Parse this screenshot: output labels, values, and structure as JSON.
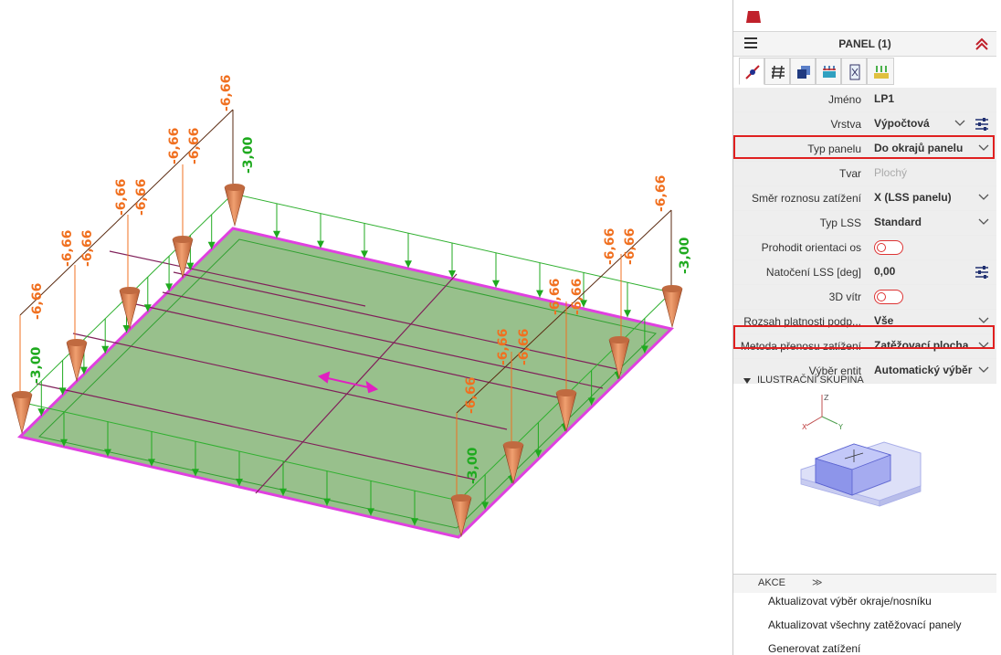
{
  "viewport": {
    "top_labels": [
      "-6,66",
      "-6,66",
      "-6,66",
      "-6,66",
      "-6,66",
      "-6,66",
      "-6,66",
      "-6,66",
      "-6,66",
      "-6,66",
      "-6,66",
      "-6,66",
      "-6,66",
      "-6,66",
      "-6,66",
      "-6,66"
    ],
    "green_labels": [
      "-3,00",
      "-3,00",
      "-3,00",
      "-3,00"
    ],
    "colors": {
      "panel_fill": "#98c08c",
      "panel_edge": "#e040e0",
      "load_top": "#f07020",
      "load_green": "#1faa1f",
      "cone": "#e0784a"
    }
  },
  "panel": {
    "title": "PANEL (1)",
    "tabs": [
      "geometry-tab",
      "layers-tab",
      "surface-tab",
      "load-tab",
      "document-tab",
      "structure-tab"
    ],
    "props": [
      {
        "key": "Jméno",
        "value": "LP1"
      },
      {
        "key": "Vrstva",
        "value": "Výpočtová"
      },
      {
        "key": "Typ panelu",
        "value": "Do okrajů panelu"
      },
      {
        "key": "Tvar",
        "value": "Plochý"
      },
      {
        "key": "Směr roznosu zatížení",
        "value": "X (LSS panelu)"
      },
      {
        "key": "Typ LSS",
        "value": "Standard"
      },
      {
        "key": "Prohodit orientaci os",
        "value": ""
      },
      {
        "key": "Natočení LSS [deg]",
        "value": "0,00"
      },
      {
        "key": "3D vítr",
        "value": ""
      },
      {
        "key": "Rozsah platnosti podp...",
        "value": "Vše"
      },
      {
        "key": "Metoda přenosu zatížení",
        "value": "Zatěžovací plocha"
      },
      {
        "key": "Výběr entit",
        "value": "Automatický výběr"
      }
    ],
    "section_title": "ILUSTRAČNÍ SKUPINA",
    "axes": {
      "z": "Z",
      "x": "X",
      "y": "Y"
    },
    "akce": {
      "label": "AKCE",
      "more": "≫"
    },
    "actions": [
      "Aktualizovat výběr okraje/nosníku",
      "Aktualizovat všechny zatěžovací panely",
      "Generovat zatížení"
    ]
  }
}
